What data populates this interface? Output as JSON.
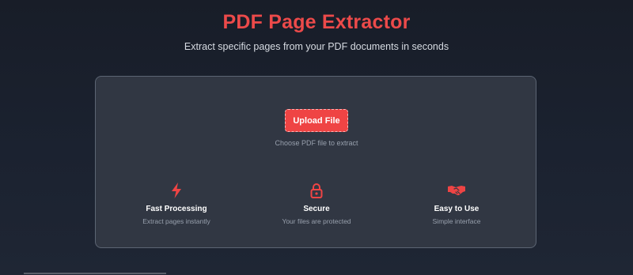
{
  "header": {
    "title": "PDF Page Extractor",
    "subtitle": "Extract specific pages from your PDF documents in seconds"
  },
  "upload": {
    "button_label": "Upload File",
    "hint": "Choose PDF file to extract"
  },
  "features": [
    {
      "icon": "bolt-icon",
      "title": "Fast Processing",
      "description": "Extract pages instantly"
    },
    {
      "icon": "lock-icon",
      "title": "Secure",
      "description": "Your files are protected"
    },
    {
      "icon": "handshake-icon",
      "title": "Easy to Use",
      "description": "Simple interface"
    }
  ],
  "colors": {
    "accent": "#ef4444",
    "background": "#1b2230",
    "card": "#313743"
  }
}
